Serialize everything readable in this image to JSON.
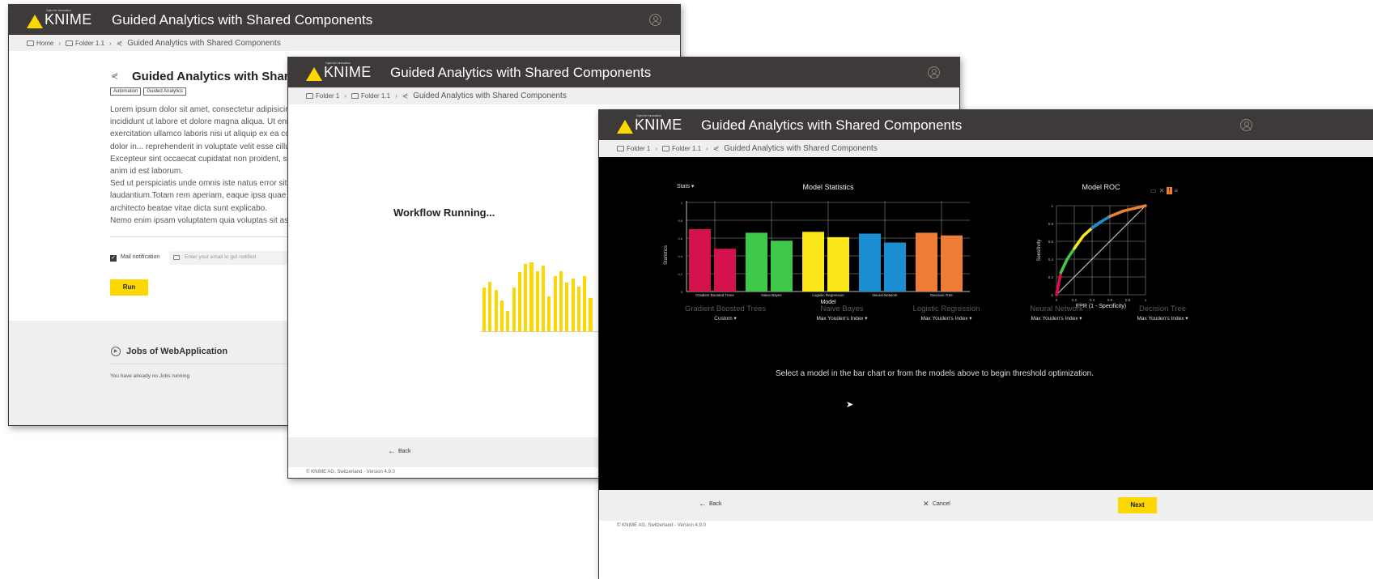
{
  "brand": {
    "name": "KNIME",
    "tagline": "Open for Innovation",
    "accent": "#fdd800",
    "header_bg": "#3e3a39"
  },
  "app_title": "Guided Analytics with Shared Components",
  "win1": {
    "breadcrumb": [
      "Home",
      "Folder 1.1",
      "Guided Analytics with Shared Components"
    ],
    "heading": "Guided Analytics with Shared Components",
    "tags": [
      "Automation",
      "Guided Analytics"
    ],
    "paragraph_lines": [
      "Lorem ipsum dolor sit amet, consectetur adipisicin",
      "incididunt ut labore et dolore magna aliqua. Ut enin",
      "exercitation ullamco laboris nisi ut aliquip ex ea cor",
      "dolor in... reprehenderit in voluptate velit esse cillun",
      "Excepteur sint occaecat cupidatat non proident, su",
      "anim id est laborum.",
      "Sed ut perspiciatis unde omnis iste natus error sit v",
      "laudantium.Totam rem aperiam, eaque ipsa quae a",
      "architecto beatae vitae dicta sunt explicabo.",
      "Nemo enim ipsam voluptatem quia voluptas sit asp"
    ],
    "mail_label": "Mail notification",
    "email_placeholder": "Enter your email to get notified",
    "run_label": "Run",
    "jobs_title": "Jobs of WebApplication",
    "jobs_empty": "You have already no Jobs running"
  },
  "win2": {
    "breadcrumb": [
      "Folder 1",
      "Folder 1.1",
      "Guided Analytics with Shared Components"
    ],
    "status": "Workflow Running...",
    "progress_bars": [
      0.42,
      0.48,
      0.4,
      0.3,
      0.2,
      0.42,
      0.57,
      0.65,
      0.66,
      0.58,
      0.63,
      0.34,
      0.53,
      0.58,
      0.47,
      0.51,
      0.43,
      0.53,
      0.32
    ],
    "back_label": "Back",
    "footer": "© KNIME AG, Switzerland - Version 4.9.0"
  },
  "win3": {
    "breadcrumb": [
      "Folder 1",
      "Folder 1.1",
      "Guided Analytics with Shared Components"
    ],
    "stats_dropdown": "Stats",
    "models": [
      {
        "name": "Gradient Boosted Trees",
        "threshold": "Custom"
      },
      {
        "name": "Naive Bayes",
        "threshold": "Max Youden's Index"
      },
      {
        "name": "Logistic Regression",
        "threshold": "Max Youden's Index"
      },
      {
        "name": "Neural Network",
        "threshold": "Max Youden's Index"
      },
      {
        "name": "Decision Tree",
        "threshold": "Max Youden's Index"
      }
    ],
    "instruction": "Select a model in the bar chart or from the models above to begin threshold optimization.",
    "back_label": "Back",
    "cancel_label": "Cancel",
    "next_label": "Next",
    "footer": "© KNIME AG, Switzerland - Version 4.9.0"
  },
  "chart_data": [
    {
      "type": "bar",
      "title": "Model Statistics",
      "xlabel": "Model",
      "ylabel": "Statistics",
      "ylim": [
        0,
        1
      ],
      "yticks": [
        "0",
        "0.2",
        "0.4",
        "0.6",
        "0.8",
        "1"
      ],
      "categories": [
        "Gradient Boosted Trees",
        "Naive Bayes",
        "Logistic Regression",
        "Neural Network",
        "Decision Tree"
      ],
      "colors": [
        "#d4124b",
        "#3ec94a",
        "#fbe81b",
        "#1b8ed1",
        "#ee7d35"
      ],
      "series": [
        {
          "values": [
            0.7,
            0.66,
            0.67,
            0.65,
            0.66
          ]
        },
        {
          "values": [
            0.48,
            0.57,
            0.61,
            0.55,
            0.63
          ]
        }
      ]
    },
    {
      "type": "line",
      "title": "Model ROC",
      "xlabel": "FPR (1 - Specificity)",
      "ylabel": "Sensitivity",
      "xlim": [
        0,
        1
      ],
      "ylim": [
        0,
        1
      ],
      "xticks": [
        "0",
        "0.2",
        "0.4",
        "0.6",
        "0.8",
        "1"
      ],
      "yticks": [
        "0",
        "0.2",
        "0.4",
        "0.6",
        "0.8",
        "1"
      ],
      "curve": [
        [
          0,
          0
        ],
        [
          0.05,
          0.25
        ],
        [
          0.12,
          0.4
        ],
        [
          0.2,
          0.52
        ],
        [
          0.3,
          0.66
        ],
        [
          0.4,
          0.75
        ],
        [
          0.5,
          0.82
        ],
        [
          0.6,
          0.88
        ],
        [
          0.75,
          0.94
        ],
        [
          1,
          1
        ]
      ],
      "curve_colors": [
        "#d4124b",
        "#3ec94a",
        "#fbe81b",
        "#1b8ed1",
        "#ee7d35"
      ]
    }
  ]
}
